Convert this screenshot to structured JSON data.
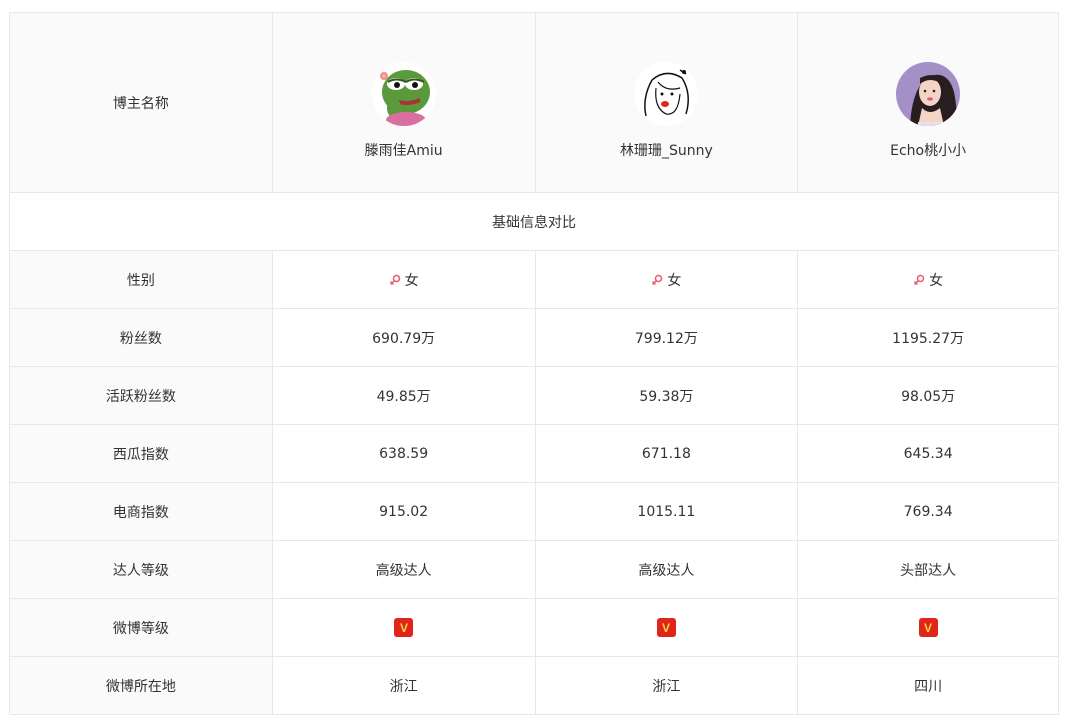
{
  "colors": {
    "border": "#e8e8e8",
    "label_bg": "#fafafa",
    "female_icon": "#e95a6a",
    "vip_badge_bg": "#e0251b",
    "vip_badge_fg": "#f8d349"
  },
  "header": {
    "label": "博主名称",
    "bloggers": [
      {
        "name": "滕雨佳Amiu",
        "avatar_icon": "pepe-frog-avatar"
      },
      {
        "name": "林珊珊_Sunny",
        "avatar_icon": "sketch-girl-avatar"
      },
      {
        "name": "Echo桃小小",
        "avatar_icon": "photo-girl-avatar"
      }
    ]
  },
  "section_title": "基础信息对比",
  "rows": [
    {
      "label": "性别",
      "values": [
        "女",
        "女",
        "女"
      ]
    },
    {
      "label": "粉丝数",
      "values": [
        "690.79万",
        "799.12万",
        "1195.27万"
      ]
    },
    {
      "label": "活跃粉丝数",
      "values": [
        "49.85万",
        "59.38万",
        "98.05万"
      ]
    },
    {
      "label": "西瓜指数",
      "values": [
        "638.59",
        "671.18",
        "645.34"
      ]
    },
    {
      "label": "电商指数",
      "values": [
        "915.02",
        "1015.11",
        "769.34"
      ]
    },
    {
      "label": "达人等级",
      "values": [
        "高级达人",
        "高级达人",
        "头部达人"
      ]
    },
    {
      "label": "微博等级",
      "values": [
        "V",
        "V",
        "V"
      ]
    },
    {
      "label": "微博所在地",
      "values": [
        "浙江",
        "浙江",
        "四川"
      ]
    }
  ]
}
